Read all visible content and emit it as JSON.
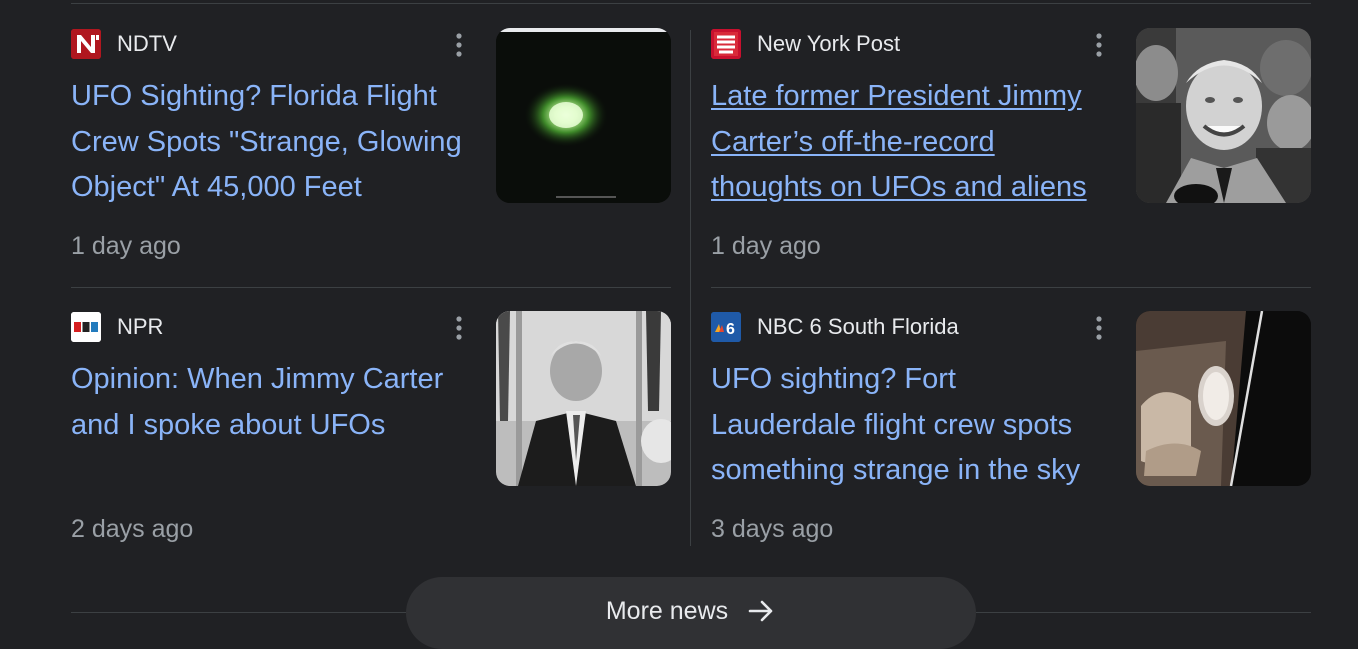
{
  "articles": [
    {
      "source": "NDTV",
      "headline": "UFO Sighting? Florida Flight Crew Spots \"Strange, Glowing Object\" At 45,000 Feet",
      "age": "1 day ago",
      "underlined": false
    },
    {
      "source": "New York Post",
      "headline": "Late former President Jimmy Carter’s off-the-record thoughts on UFOs and aliens",
      "age": "1 day ago",
      "underlined": true
    },
    {
      "source": "NPR",
      "headline": "Opinion: When Jimmy Carter and I spoke about UFOs",
      "age": "2 days ago",
      "underlined": false
    },
    {
      "source": "NBC 6 South Florida",
      "headline": "UFO sighting? Fort Lauderdale flight crew spots something strange in the sky",
      "age": "3 days ago",
      "underlined": false
    }
  ],
  "favicons": {
    "ndtv": {
      "text": "N",
      "bg": "#b0171f",
      "fg": "#ffffff"
    },
    "nypost": {
      "text": "NEW YORK POST",
      "bg": "#c8102e",
      "fg": "#ffffff"
    },
    "npr": {
      "text": "npr",
      "bg": "#ffffff",
      "fg": "#d62021"
    },
    "nbc6": {
      "text": "6",
      "bg": "#1f5aa8",
      "fg": "#ffffff"
    }
  },
  "more_news": {
    "label": "More news",
    "icon": "arrow-right-icon"
  },
  "colors": {
    "background": "#202124",
    "link": "#8ab4f8",
    "meta": "#9aa0a6",
    "divider": "#3c4043",
    "button": "#303134"
  }
}
